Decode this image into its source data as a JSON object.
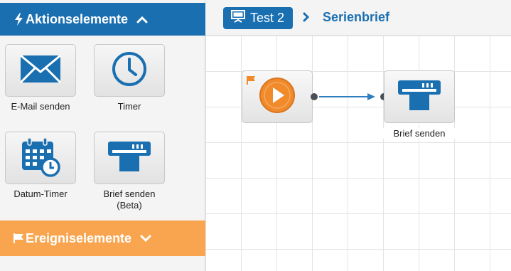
{
  "sidebar": {
    "actions_header": "Aktionselemente",
    "events_header": "Ereigniselemente",
    "tiles": [
      {
        "label": "E-Mail senden",
        "icon": "envelope-icon"
      },
      {
        "label": "Timer",
        "icon": "clock-icon"
      },
      {
        "label": "Datum-Timer",
        "icon": "calendar-clock-icon"
      },
      {
        "label": "Brief senden\n(Beta)",
        "icon": "printer-icon"
      }
    ]
  },
  "topbar": {
    "campaign_label": "Test 2",
    "breadcrumb": "Serienbrief"
  },
  "canvas": {
    "nodes": [
      {
        "label": "",
        "icon": "play-icon",
        "flag": "flag-icon"
      },
      {
        "label": "Brief senden",
        "icon": "printer-icon"
      }
    ]
  },
  "colors": {
    "primary": "#1a6fb1",
    "events": "#f9a54f",
    "play": "#f08a2b"
  }
}
